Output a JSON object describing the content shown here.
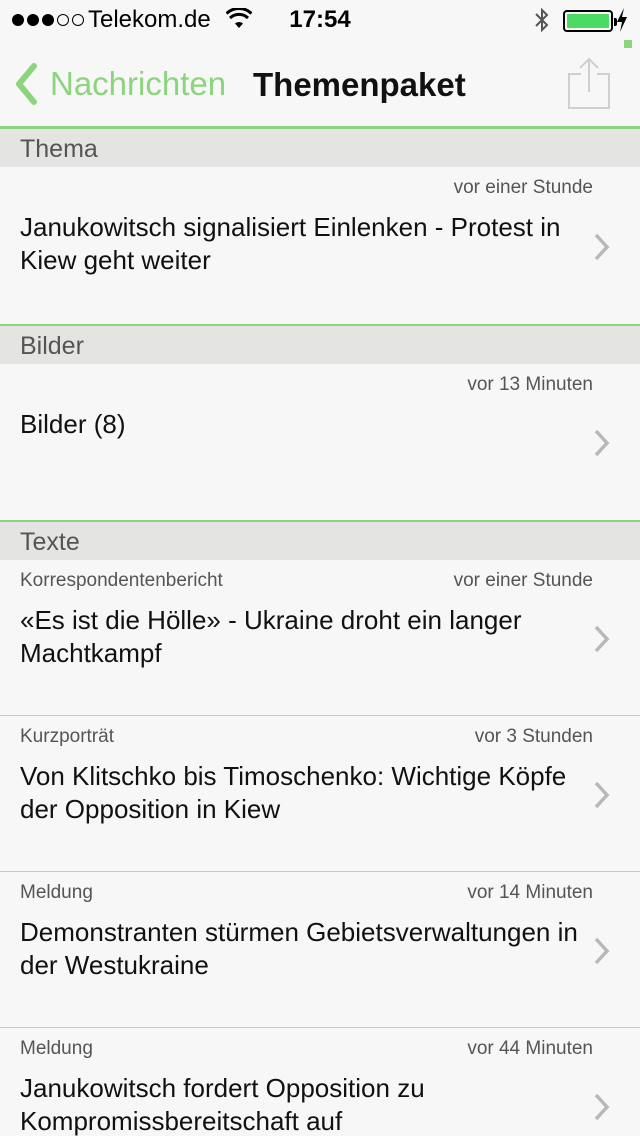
{
  "status_bar": {
    "carrier": "Telekom.de",
    "time": "17:54",
    "signal_bars_filled": 3,
    "signal_bars_total": 5,
    "battery_level": 1.0,
    "wifi_icon": "wifi-icon",
    "bluetooth_icon": "bluetooth-icon",
    "charging_icon": "charging-bolt-icon"
  },
  "nav": {
    "back_label": "Nachrichten",
    "title": "Themenpaket",
    "share_icon": "share-icon",
    "accent_color": "#8cd47e"
  },
  "sections": {
    "thema": {
      "header": "Thema",
      "items": [
        {
          "category": "",
          "time": "vor einer Stunde",
          "title": "Janukowitsch signalisiert Einlenken - Protest in Kiew geht weiter"
        }
      ]
    },
    "bilder": {
      "header": "Bilder",
      "items": [
        {
          "category": "",
          "time": "vor 13 Minuten",
          "title": "Bilder (8)"
        }
      ]
    },
    "texte": {
      "header": "Texte",
      "items": [
        {
          "category": "Korrespondentenbericht",
          "time": "vor einer Stunde",
          "title": "«Es ist die Hölle» - Ukraine droht ein langer Machtkampf"
        },
        {
          "category": "Kurzporträt",
          "time": "vor 3 Stunden",
          "title": "Von Klitschko bis Timoschenko: Wichtige Köpfe der Opposition in Kiew"
        },
        {
          "category": "Meldung",
          "time": "vor 14 Minuten",
          "title": "Demonstranten stürmen Gebietsverwaltungen in der Westukraine"
        },
        {
          "category": "Meldung",
          "time": "vor 44 Minuten",
          "title": "Janukowitsch fordert Opposition zu Kompromissbereitschaft auf"
        }
      ]
    }
  }
}
